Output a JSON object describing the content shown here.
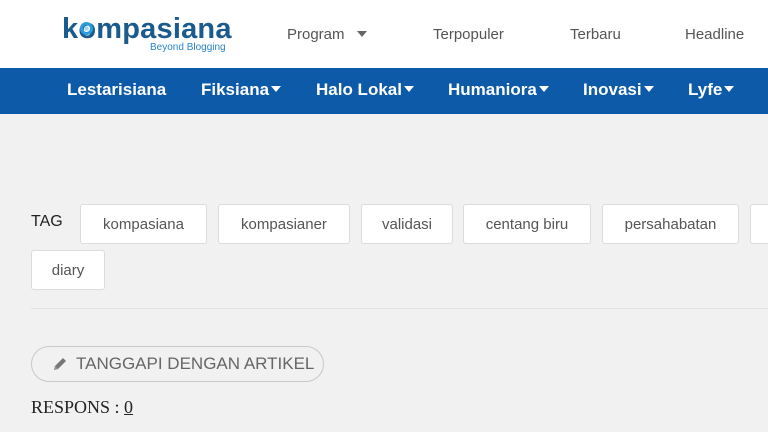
{
  "header": {
    "logo": {
      "wordmark": "kompasiana",
      "tagline": "Beyond Blogging"
    },
    "nav": [
      {
        "label": "Program",
        "has_dropdown": true
      },
      {
        "label": "Terpopuler",
        "has_dropdown": false
      },
      {
        "label": "Terbaru",
        "has_dropdown": false
      },
      {
        "label": "Headline",
        "has_dropdown": false
      }
    ]
  },
  "categories": [
    {
      "label": "Lestarisiana",
      "has_dropdown": false
    },
    {
      "label": "Fiksiana",
      "has_dropdown": true
    },
    {
      "label": "Halo Lokal",
      "has_dropdown": true
    },
    {
      "label": "Humaniora",
      "has_dropdown": true
    },
    {
      "label": "Inovasi",
      "has_dropdown": true
    },
    {
      "label": "Lyfe",
      "has_dropdown": true
    }
  ],
  "tags": {
    "label": "TAG",
    "items": [
      "kompasiana",
      "kompasianer",
      "validasi",
      "centang biru",
      "persahabatan",
      "",
      "diary"
    ]
  },
  "respond": {
    "button_label": "TANGGAPI DENGAN ARTIKEL",
    "icon": "pencil-icon",
    "responses_label": "RESPONS :",
    "responses_count": "0"
  },
  "colors": {
    "brand_dark": "#1a5a8c",
    "brand_light": "#2a86c8",
    "category_bar": "#0d5aa8",
    "page_background": "#f1f1f1"
  }
}
